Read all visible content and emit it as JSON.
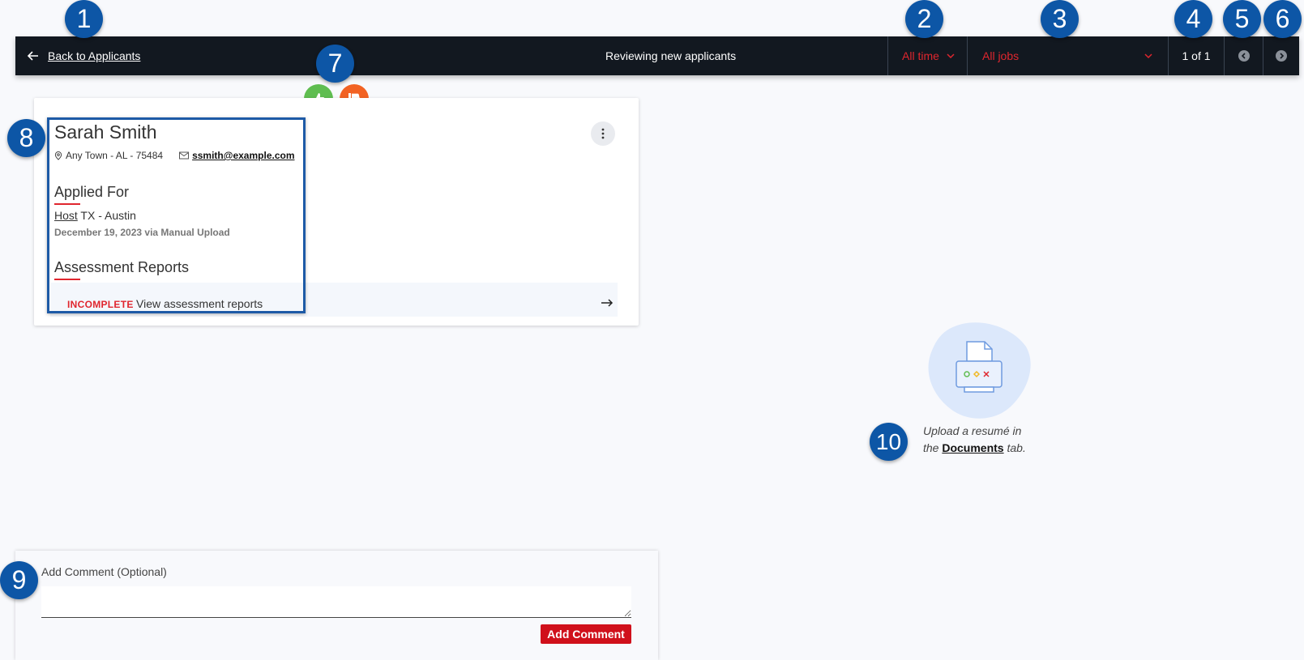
{
  "topbar": {
    "back_label": "Back to Applicants",
    "title": "Reviewing new applicants",
    "time_filter": "All time",
    "jobs_filter": "All jobs",
    "page_indicator": "1 of 1"
  },
  "markers": [
    "1",
    "2",
    "3",
    "4",
    "5",
    "6",
    "7",
    "8",
    "9",
    "10"
  ],
  "applicant": {
    "name": "Sarah Smith",
    "location": "Any Town - AL - 75484",
    "email": "ssmith@example.com",
    "applied_for_heading": "Applied For",
    "job_link": "Host",
    "job_location": " TX - Austin",
    "applied_date": "December 19, 2023 via Manual Upload",
    "assessment_heading": "Assessment Reports",
    "assessment_status": "INCOMPLETE",
    "assessment_link": "View assessment reports"
  },
  "comment": {
    "label": "Add Comment (Optional)",
    "value": "",
    "button": "Add Comment"
  },
  "resume": {
    "line1": "Upload a resumé in",
    "line2_prefix": "the ",
    "documents_link": "Documents",
    "line2_suffix": " tab."
  },
  "colors": {
    "topbar": "#121820",
    "accent_red": "#e0262e",
    "thumbs_up": "#5fbd50",
    "thumbs_down": "#f26223",
    "marker": "#0d56a6"
  },
  "icons": [
    "arrow-left-icon",
    "chevron-down-icon",
    "chevron-left-icon",
    "chevron-right-icon",
    "thumbs-up-icon",
    "thumbs-down-icon",
    "location-pin-icon",
    "mail-icon",
    "kebab-menu-icon",
    "arrow-right-icon",
    "printer-icon"
  ]
}
